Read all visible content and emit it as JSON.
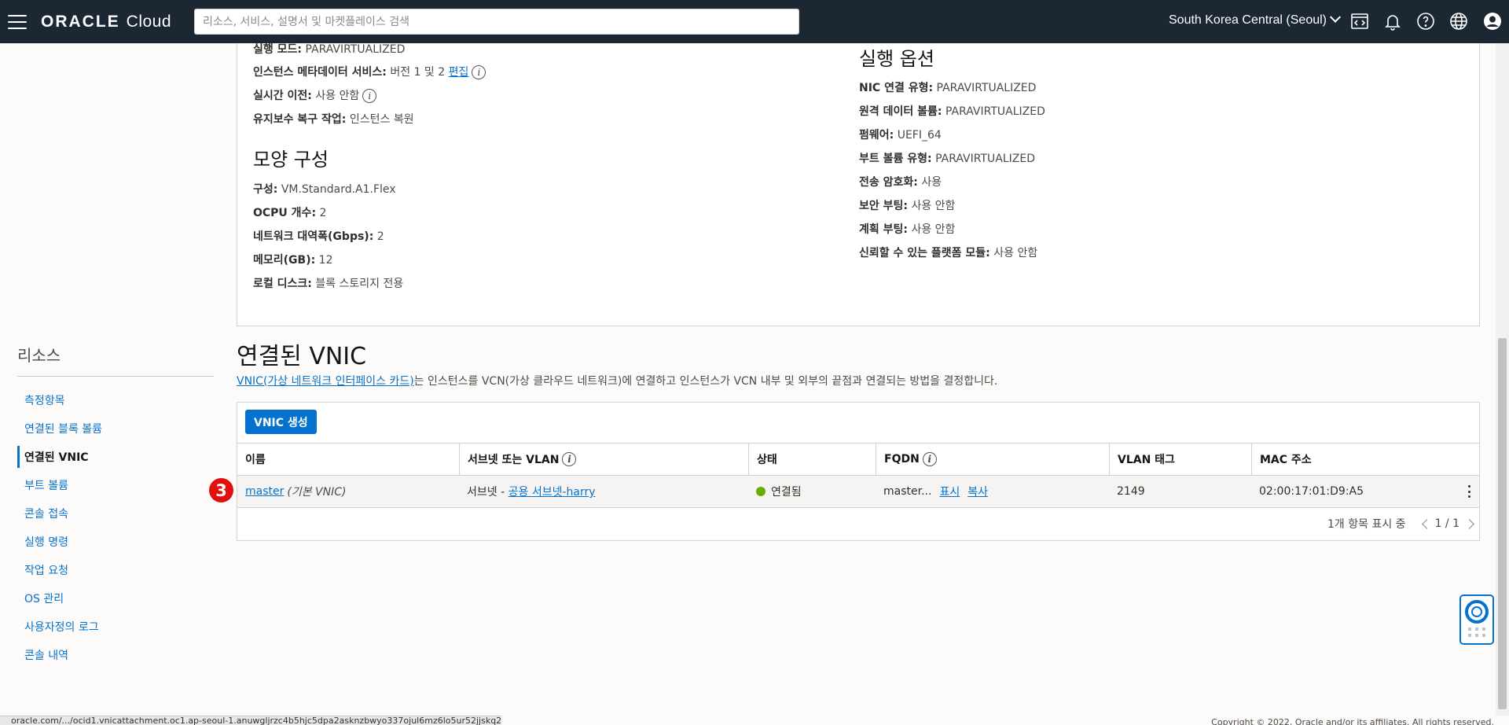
{
  "header": {
    "logo_brand": "ORACLE",
    "logo_product": "Cloud",
    "search_placeholder": "리소스, 서비스, 설명서 및 마켓플레이스 검색",
    "region": "South Korea Central (Seoul)",
    "icons": [
      "code-editor-icon",
      "bell-icon",
      "help-icon",
      "globe-icon",
      "user-icon"
    ]
  },
  "details": {
    "launch_mode_label": "실행 모드:",
    "launch_mode_value": "PARAVIRTUALIZED",
    "metadata_label": "인스턴스 메타데이터 서비스:",
    "metadata_value": "버전 1 및 2",
    "metadata_edit": "편집",
    "live_migration_label": "실시간 이전:",
    "live_migration_value": "사용 안함",
    "maintenance_label": "유지보수 복구 작업:",
    "maintenance_value": "인스턴스 복원",
    "shape_heading": "모양 구성",
    "shape_label": "구성:",
    "shape_value": "VM.Standard.A1.Flex",
    "ocpu_label": "OCPU 개수:",
    "ocpu_value": "2",
    "bandwidth_label": "네트워크 대역폭(Gbps):",
    "bandwidth_value": "2",
    "memory_label": "메모리(GB):",
    "memory_value": "12",
    "local_disk_label": "로컬 디스크:",
    "local_disk_value": "블록 스토리지 전용"
  },
  "launch_options": {
    "heading": "실행 옵션",
    "nic_label": "NIC 연결 유형:",
    "nic_value": "PARAVIRTUALIZED",
    "remote_volume_label": "원격 데이터 볼륨:",
    "remote_volume_value": "PARAVIRTUALIZED",
    "firmware_label": "펌웨어:",
    "firmware_value": "UEFI_64",
    "boot_volume_label": "부트 볼륨 유형:",
    "boot_volume_value": "PARAVIRTUALIZED",
    "in_transit_label": "전송 암호화:",
    "in_transit_value": "사용",
    "secure_boot_label": "보안 부팅:",
    "secure_boot_value": "사용 안함",
    "measured_boot_label": "계획 부팅:",
    "measured_boot_value": "사용 안함",
    "tpm_label": "신뢰할 수 있는 플랫폼 모듈:",
    "tpm_value": "사용 안함"
  },
  "sidebar": {
    "title": "리소스",
    "items": [
      {
        "label": "측정항목",
        "active": false
      },
      {
        "label": "연결된 블록 볼륨",
        "active": false
      },
      {
        "label": "연결된 VNIC",
        "active": true
      },
      {
        "label": "부트 볼륨",
        "active": false
      },
      {
        "label": "콘솔 접속",
        "active": false
      },
      {
        "label": "실행 명령",
        "active": false
      },
      {
        "label": "작업 요청",
        "active": false
      },
      {
        "label": "OS 관리",
        "active": false
      },
      {
        "label": "사용자정의 로그",
        "active": false
      },
      {
        "label": "콘솔 내역",
        "active": false
      }
    ]
  },
  "vnic": {
    "title": "연결된 VNIC",
    "desc_link": "VNIC(가상 네트워크 인터페이스 카드)",
    "desc_rest": "는 인스턴스를 VCN(가상 클라우드 네트워크)에 연결하고 인스턴스가 VCN 내부 및 외부의 끝점과 연결되는 방법을 결정합니다.",
    "create_button": "VNIC 생성",
    "columns": [
      "이름",
      "서브넷 또는 VLAN",
      "상태",
      "FQDN",
      "VLAN 태그",
      "MAC 주소"
    ],
    "rows": [
      {
        "name": "master",
        "name_note": "(기본 VNIC)",
        "subnet_prefix": "서브넷 -",
        "subnet_link": "공용 서브넷-harry",
        "state": "연결됨",
        "fqdn": "master...",
        "fqdn_show": "표시",
        "fqdn_copy": "복사",
        "vlan_tag": "2149",
        "mac": "02:00:17:01:D9:A5"
      }
    ],
    "pager_text": "1개 항목 표시 중",
    "pager_pages": "1 / 1",
    "status_color": "#6aad00"
  },
  "annotation_badge": "3",
  "footer": {
    "status_url": "oracle.com/.../ocid1.vnicattachment.oc1.ap-seoul-1.anuwgljrzc4b5hjc5dpa2asknzbwyo337ojul6mz6lo5ur52jjskq2",
    "copyright": "Copyright © 2022, Oracle and/or its affiliates. All rights reserved."
  },
  "colors": {
    "header_bg": "#1b2834",
    "accent": "#0572ce",
    "badge": "#e30e0e"
  }
}
